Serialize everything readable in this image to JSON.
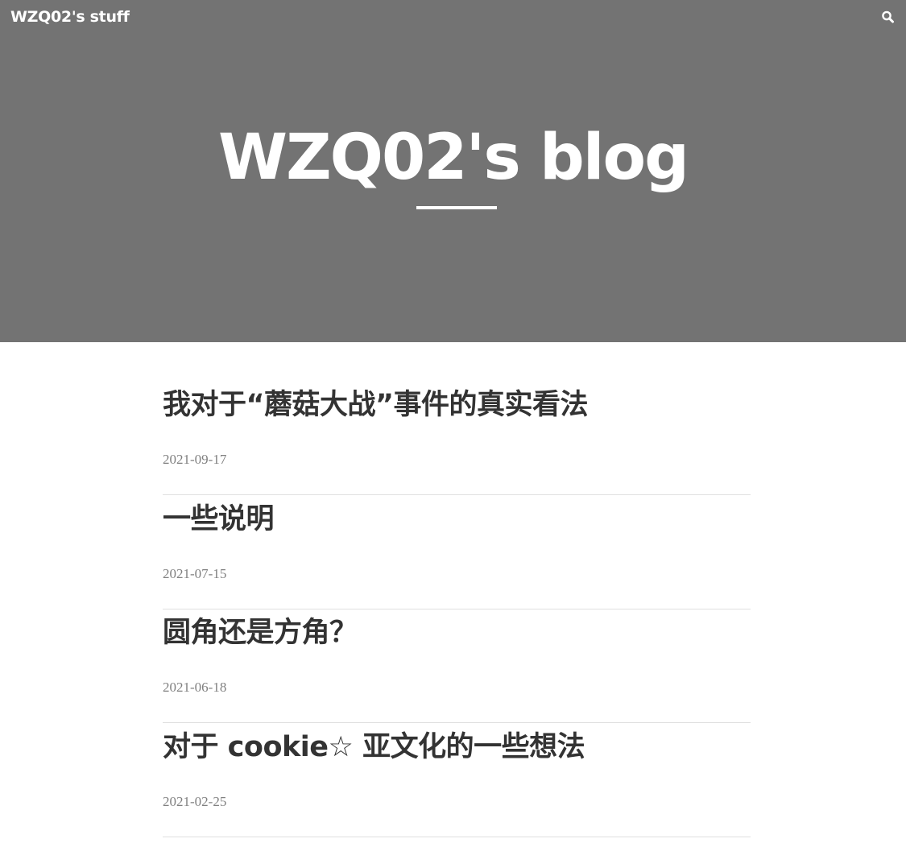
{
  "header": {
    "site_name": "WZQ02's stuff",
    "search_icon": "search-icon",
    "blog_title": "WZQ02's blog",
    "background_color": "#737373"
  },
  "posts": [
    {
      "title": "我对于“蘑菇大战”事件的真实看法",
      "date": "2021-09-17"
    },
    {
      "title": "一些说明",
      "date": "2021-07-15"
    },
    {
      "title": "圆角还是方角？",
      "date": "2021-06-18"
    },
    {
      "title": "对于 cookie☆ 亚文化的一些想法",
      "date": "2021-02-25"
    }
  ],
  "colors": {
    "title_text": "#333333",
    "date_text": "#808080",
    "divider": "#e0e0e0"
  }
}
